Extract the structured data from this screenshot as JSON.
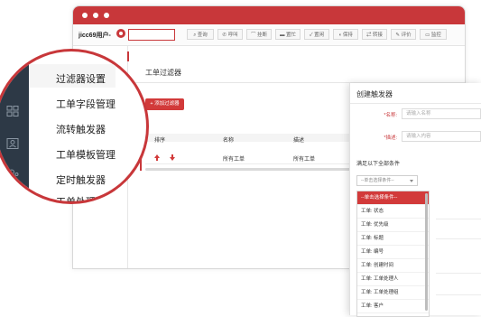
{
  "toolbar": {
    "user_name": "jicc69用户-",
    "buttons": [
      {
        "label": "查询",
        "icon": "search-icon"
      },
      {
        "label": "呼叫",
        "icon": "phone-icon"
      },
      {
        "label": "挂断",
        "icon": "hangup-icon"
      },
      {
        "label": "置忙",
        "icon": "busy-icon"
      },
      {
        "label": "置闲",
        "icon": "idle-icon"
      },
      {
        "label": "保持",
        "icon": "hold-icon"
      },
      {
        "label": "转接",
        "icon": "transfer-icon"
      },
      {
        "label": "评价",
        "icon": "edit-icon"
      },
      {
        "label": "监控",
        "icon": "monitor-icon"
      }
    ]
  },
  "sidebar": {
    "items": [
      {
        "label": "过滤器设置"
      },
      {
        "label": "工单字段管理"
      },
      {
        "label": "流转触发器"
      },
      {
        "label": "工单模板管理"
      },
      {
        "label": "定时触发器"
      },
      {
        "label": "工单处理时..."
      }
    ]
  },
  "main": {
    "title": "工单过滤器",
    "add_button": "+ 添加过滤器",
    "table": {
      "headers": [
        "排序",
        "名称",
        "描述"
      ],
      "rows": [
        {
          "name": "所有工单",
          "description": "所有工单"
        }
      ]
    }
  },
  "panel": {
    "title": "创建触发器",
    "name_label": "*名称:",
    "name_placeholder": "请输入名称",
    "desc_label": "*描述:",
    "desc_placeholder": "请输入内容",
    "conditions_label": "满足以下全部条件",
    "select_value": "--单击选择条件--",
    "options": [
      "--单击选择条件--",
      "工单: 状态",
      "工单: 优先级",
      "工单: 标题",
      "工单: 编号",
      "工单: 创建时间",
      "工单: 工单处理人",
      "工单: 工单处理组",
      "工单: 客户"
    ]
  },
  "colors": {
    "accent": "#c8373a",
    "sidebar_dark": "#2d3946"
  }
}
